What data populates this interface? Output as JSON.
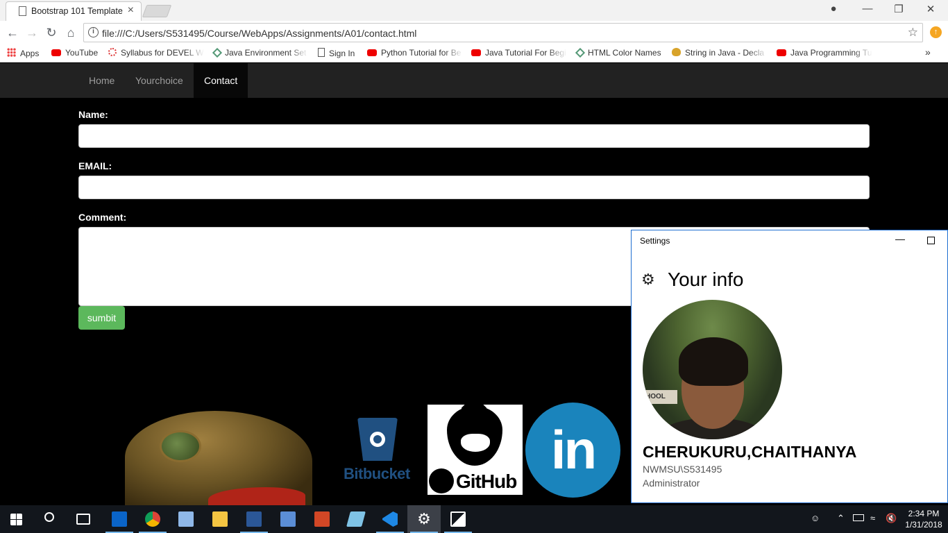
{
  "browser": {
    "tab_title": "Bootstrap 101 Template",
    "url": "file:///C:/Users/S531495/Course/WebApps/Assignments/A01/contact.html",
    "bookmarks": [
      {
        "label": "Apps",
        "icon": "apps-grid-icon"
      },
      {
        "label": "YouTube",
        "icon": "youtube-icon"
      },
      {
        "label": "Syllabus for DEVEL W",
        "icon": "syllabus-icon"
      },
      {
        "label": "Java Environment Set",
        "icon": "java-env-icon"
      },
      {
        "label": "Sign In",
        "icon": "page-icon"
      },
      {
        "label": "Python Tutorial for Be",
        "icon": "youtube-icon"
      },
      {
        "label": "Java Tutorial For Begi",
        "icon": "youtube-icon"
      },
      {
        "label": "HTML Color Names",
        "icon": "html-colors-icon"
      },
      {
        "label": "String in Java - Decla",
        "icon": "coffee-icon"
      },
      {
        "label": "Java Programming Tu",
        "icon": "youtube-icon"
      }
    ],
    "more_bookmarks": "»"
  },
  "nav": {
    "links": [
      "Home",
      "Yourchoice",
      "Contact"
    ],
    "active": "Contact"
  },
  "form": {
    "name_label": "Name:",
    "email_label": "EMAIL:",
    "comment_label": "Comment:",
    "submit_label": "sumbit"
  },
  "logos": {
    "bitbucket": "Bitbucket",
    "github": "GitHub",
    "linkedin": "in"
  },
  "settings": {
    "window_title": "Settings",
    "heading": "Your info",
    "user_name": "CHERUKURU,CHAITHANYA",
    "account": "NWMSU\\S531495",
    "role": "Administrator",
    "photo_text": "HOOL"
  },
  "taskbar": {
    "time": "2:34 PM",
    "date": "1/31/2018"
  }
}
